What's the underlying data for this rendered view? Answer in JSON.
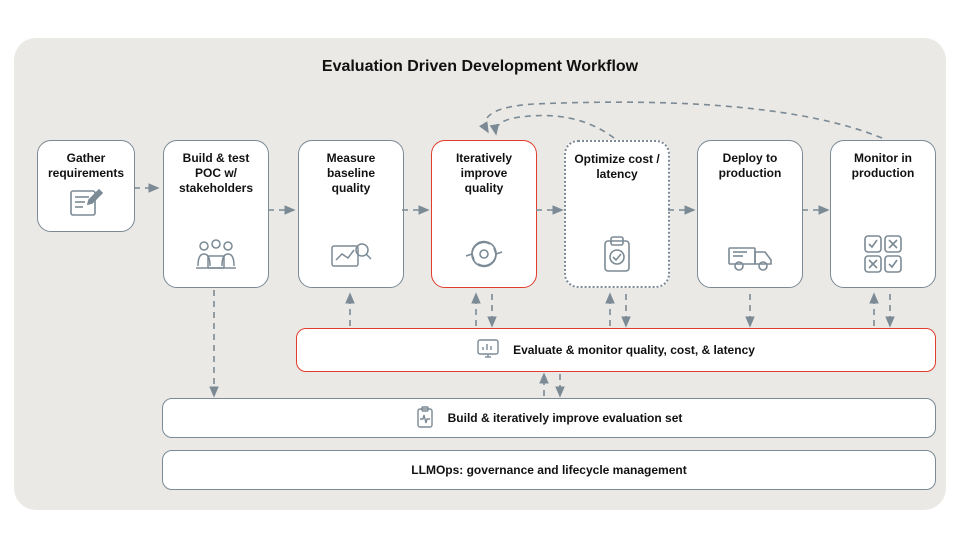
{
  "title": "Evaluation Driven Development Workflow",
  "steps": {
    "s1": "Gather\nrequirements",
    "s2": "Build & test\nPOC w/\nstakeholders",
    "s3": "Measure\nbaseline\nquality",
    "s4": "Iteratively\nimprove\nquality",
    "s5": "Optimize cost /\nlatency",
    "s6": "Deploy to\nproduction",
    "s7": "Monitor in\nproduction"
  },
  "strips": {
    "eval": "Evaluate & monitor quality, cost, & latency",
    "build": "Build & iteratively improve evaluation set",
    "llmops": "LLMOps: governance and lifecycle management"
  }
}
